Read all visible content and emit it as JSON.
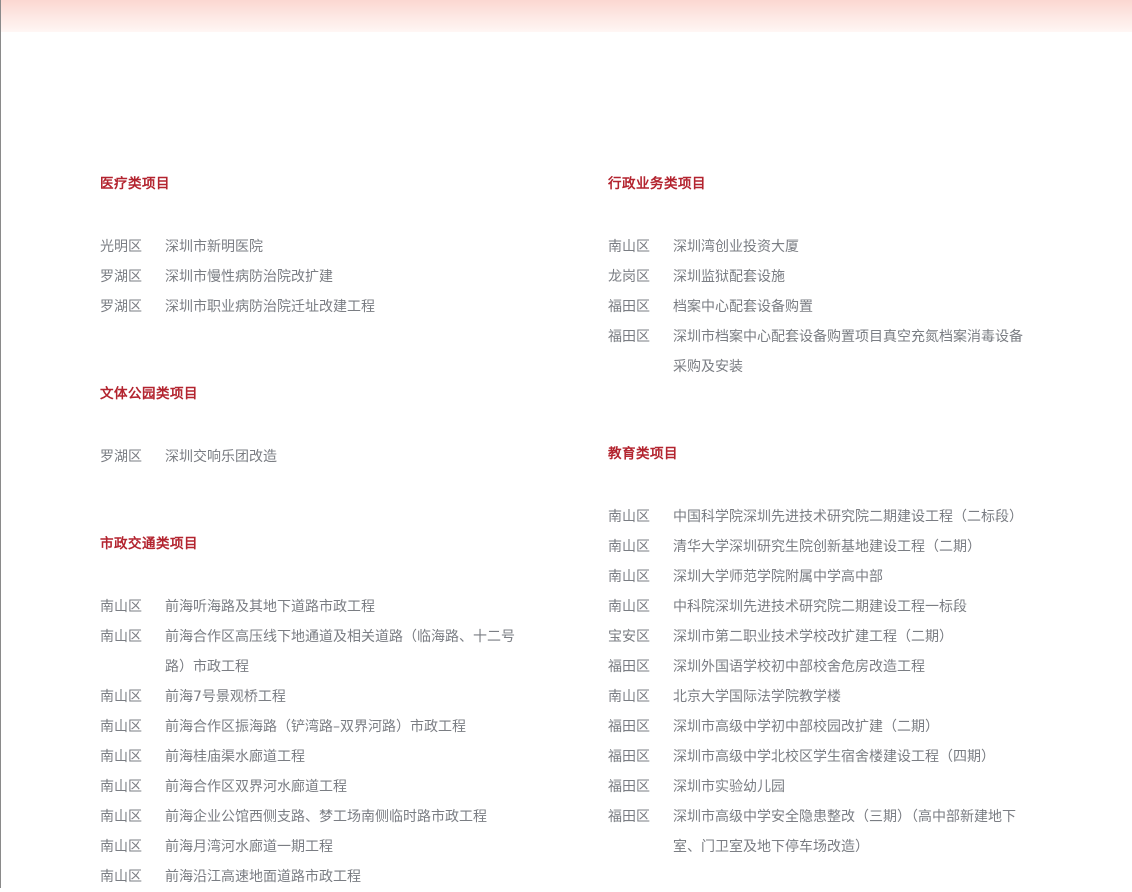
{
  "left_column": [
    {
      "heading": "医疗类项目",
      "items": [
        {
          "district": "光明区",
          "name": "深圳市新明医院"
        },
        {
          "district": "罗湖区",
          "name": "深圳市慢性病防治院改扩建"
        },
        {
          "district": "罗湖区",
          "name": "深圳市职业病防治院迁址改建工程"
        }
      ]
    },
    {
      "heading": "文体公园类项目",
      "items": [
        {
          "district": "罗湖区",
          "name": "深圳交响乐团改造"
        }
      ]
    },
    {
      "heading": "市政交通类项目",
      "items": [
        {
          "district": "南山区",
          "name": "前海听海路及其地下道路市政工程"
        },
        {
          "district": "南山区",
          "name": "前海合作区高压线下地通道及相关道路（临海路、十二号路）市政工程"
        },
        {
          "district": "南山区",
          "name": "前海7号景观桥工程"
        },
        {
          "district": "南山区",
          "name": "前海合作区振海路（铲湾路–双界河路）市政工程"
        },
        {
          "district": "南山区",
          "name": "前海桂庙渠水廊道工程"
        },
        {
          "district": "南山区",
          "name": "前海合作区双界河水廊道工程"
        },
        {
          "district": "南山区",
          "name": "前海企业公馆西侧支路、梦工场南侧临时路市政工程"
        },
        {
          "district": "南山区",
          "name": "前海月湾河水廊道一期工程"
        },
        {
          "district": "南山区",
          "name": "前海沿江高速地面道路市政工程"
        }
      ]
    }
  ],
  "right_column": [
    {
      "heading": "行政业务类项目",
      "items": [
        {
          "district": "南山区",
          "name": "深圳湾创业投资大厦"
        },
        {
          "district": "龙岗区",
          "name": "深圳监狱配套设施"
        },
        {
          "district": "福田区",
          "name": "档案中心配套设备购置"
        },
        {
          "district": "福田区",
          "name": "深圳市档案中心配套设备购置项目真空充氮档案消毒设备采购及安装"
        }
      ]
    },
    {
      "heading": "教育类项目",
      "items": [
        {
          "district": "南山区",
          "name": "中国科学院深圳先进技术研究院二期建设工程（二标段）"
        },
        {
          "district": "南山区",
          "name": "清华大学深圳研究生院创新基地建设工程（二期）"
        },
        {
          "district": "南山区",
          "name": "深圳大学师范学院附属中学高中部"
        },
        {
          "district": "南山区",
          "name": "中科院深圳先进技术研究院二期建设工程一标段"
        },
        {
          "district": "宝安区",
          "name": "深圳市第二职业技术学校改扩建工程（二期）"
        },
        {
          "district": "福田区",
          "name": "深圳外国语学校初中部校舍危房改造工程"
        },
        {
          "district": "南山区",
          "name": "北京大学国际法学院教学楼"
        },
        {
          "district": "福田区",
          "name": "深圳市高级中学初中部校园改扩建（二期）"
        },
        {
          "district": "福田区",
          "name": "深圳市高级中学北校区学生宿舍楼建设工程（四期）"
        },
        {
          "district": "福田区",
          "name": "深圳市实验幼儿园"
        },
        {
          "district": "福田区",
          "name": "深圳市高级中学安全隐患整改（三期）（高中部新建地下室、门卫室及地下停车场改造）"
        }
      ]
    }
  ],
  "colors": {
    "heading": "#b3242f",
    "body_text": "#7a7d83",
    "top_band": "#fbd7d1"
  }
}
